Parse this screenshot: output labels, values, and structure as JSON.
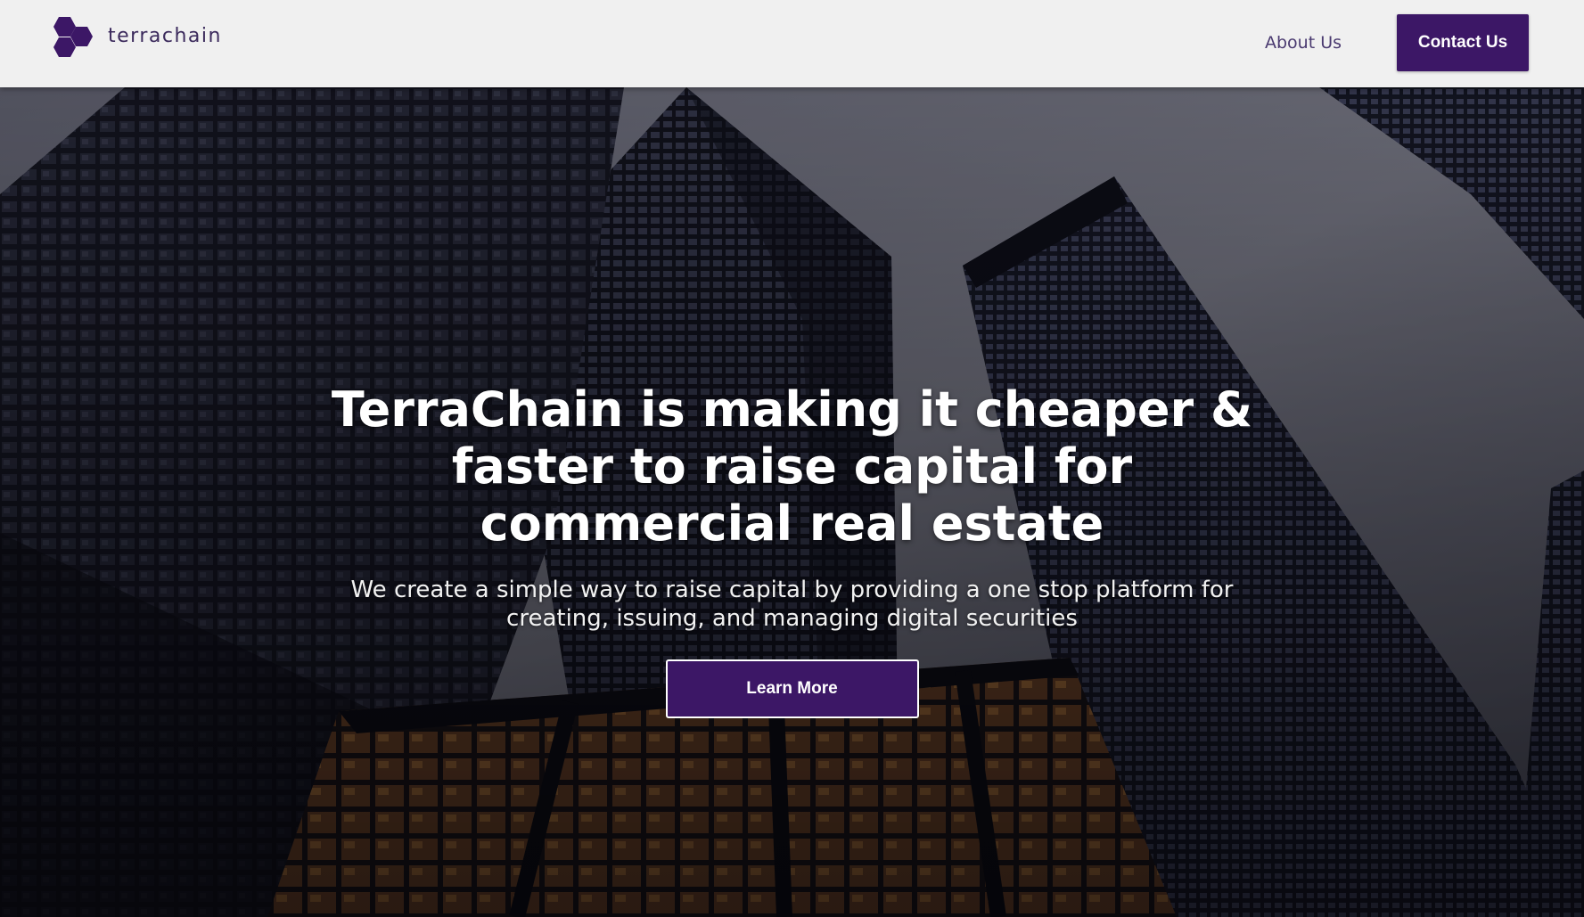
{
  "brand": {
    "name": "terrachain",
    "logo_icon": "hexagon-cluster-icon",
    "accent_color": "#3c1766"
  },
  "nav": {
    "about_label": "About Us",
    "contact_label": "Contact Us"
  },
  "hero": {
    "background": "city-skyscrapers-photo",
    "title": "TerraChain is making it cheaper & faster to raise capital for commercial real estate",
    "subtitle": "We create a simple way to raise capital by providing a one stop platform for creating, issuing, and managing digital securities",
    "cta_label": "Learn More"
  }
}
